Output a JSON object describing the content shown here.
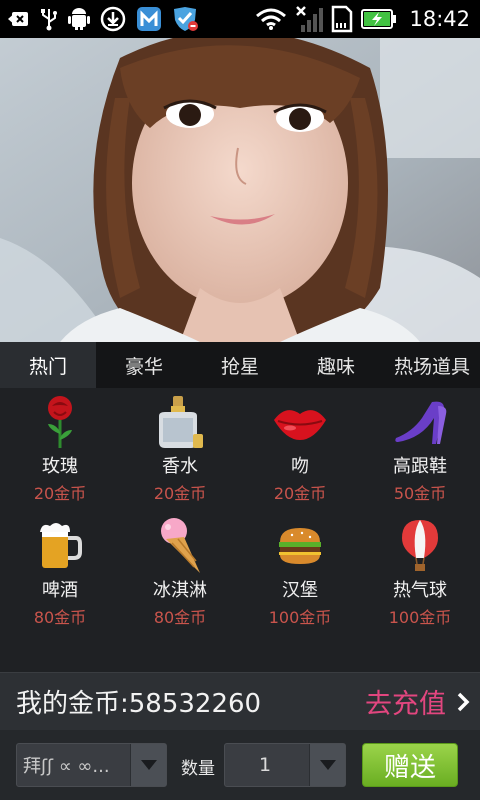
{
  "status_bar": {
    "time": "18:42",
    "icons": [
      "back-icon",
      "usb-icon",
      "android-debug-icon",
      "download-icon",
      "mail-app-icon",
      "shield-app-icon",
      "wifi-icon",
      "no-signal-icon",
      "sd-card-icon",
      "battery-charging-icon"
    ]
  },
  "photo": {
    "description_icon": "profile-photo"
  },
  "tabs": [
    {
      "label": "热门",
      "active": true
    },
    {
      "label": "豪华"
    },
    {
      "label": "抢星"
    },
    {
      "label": "趣味"
    },
    {
      "label": "热场道具"
    }
  ],
  "gifts": [
    {
      "name": "玫瑰",
      "price": "20金币",
      "icon": "rose-icon"
    },
    {
      "name": "香水",
      "price": "20金币",
      "icon": "perfume-icon"
    },
    {
      "name": "吻",
      "price": "20金币",
      "icon": "lips-icon"
    },
    {
      "name": "高跟鞋",
      "price": "50金币",
      "icon": "high-heel-icon"
    },
    {
      "name": "啤酒",
      "price": "80金币",
      "icon": "beer-icon"
    },
    {
      "name": "冰淇淋",
      "price": "80金币",
      "icon": "ice-cream-icon"
    },
    {
      "name": "汉堡",
      "price": "100金币",
      "icon": "burger-icon"
    },
    {
      "name": "热气球",
      "price": "100金币",
      "icon": "hot-air-balloon-icon"
    }
  ],
  "coins": {
    "label": "我的金币:58532260",
    "recharge_label": "去充值"
  },
  "send_bar": {
    "recipient": "拜ʃʃ ∝ ∞...",
    "quantity_label": "数量",
    "quantity_value": "1",
    "send_label": "赠送"
  },
  "colors": {
    "accent_pink": "#e2467f",
    "price_red": "#c9544c",
    "send_green": "#7bbf2f"
  }
}
